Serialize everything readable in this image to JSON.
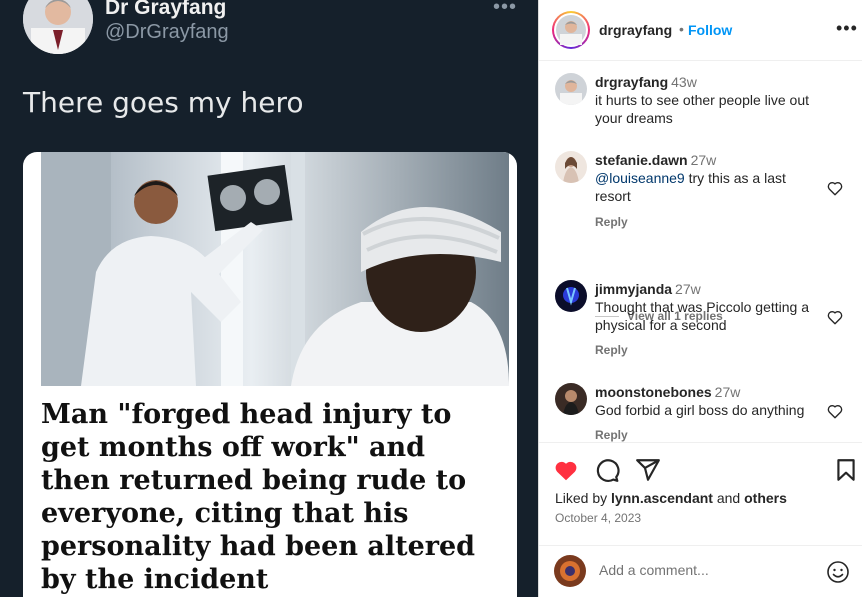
{
  "tweet": {
    "display_name": "Dr Grayfang",
    "handle": "@DrGrayfang",
    "more_icon": "more-horizontal-icon",
    "text": "There goes my hero",
    "headline": "Man \"forged head injury to get months off work\" and then returned being rude to everyone, citing that his personality had been altered by the incident"
  },
  "header": {
    "username": "drgrayfang",
    "separator": "•",
    "follow_label": "Follow",
    "more_icon": "more-horizontal-icon"
  },
  "comments": [
    {
      "user": "drgrayfang",
      "time": "43w",
      "text": "it hurts to see other people live out your dreams"
    },
    {
      "user": "stefanie.dawn",
      "time": "27w",
      "mention": "@louiseanne9",
      "text": " try this as a last resort",
      "reply": "Reply"
    },
    {
      "user": "jimmyjanda",
      "time": "27w",
      "text": "Thought that was Piccolo getting a physical for a second",
      "reply": "Reply"
    },
    {
      "user": "moonstonebones",
      "time": "27w",
      "text": "God forbid a girl boss do anything",
      "reply": "Reply"
    }
  ],
  "view_replies": "View all 1 replies",
  "actions": {
    "like_icon": "heart-filled-icon",
    "comment_icon": "comment-icon",
    "share_icon": "send-icon",
    "save_icon": "bookmark-icon",
    "liked_by_prefix": "Liked by ",
    "liked_by_user": "lynn.ascendant",
    "liked_by_and": " and ",
    "liked_by_others": "others",
    "date": "October 4, 2023"
  },
  "add_comment": {
    "placeholder": "Add a comment...",
    "emoji_icon": "emoji-icon"
  },
  "colors": {
    "like_red": "#ff3040",
    "follow_blue": "#0095f6",
    "tweet_bg": "#15202b"
  }
}
